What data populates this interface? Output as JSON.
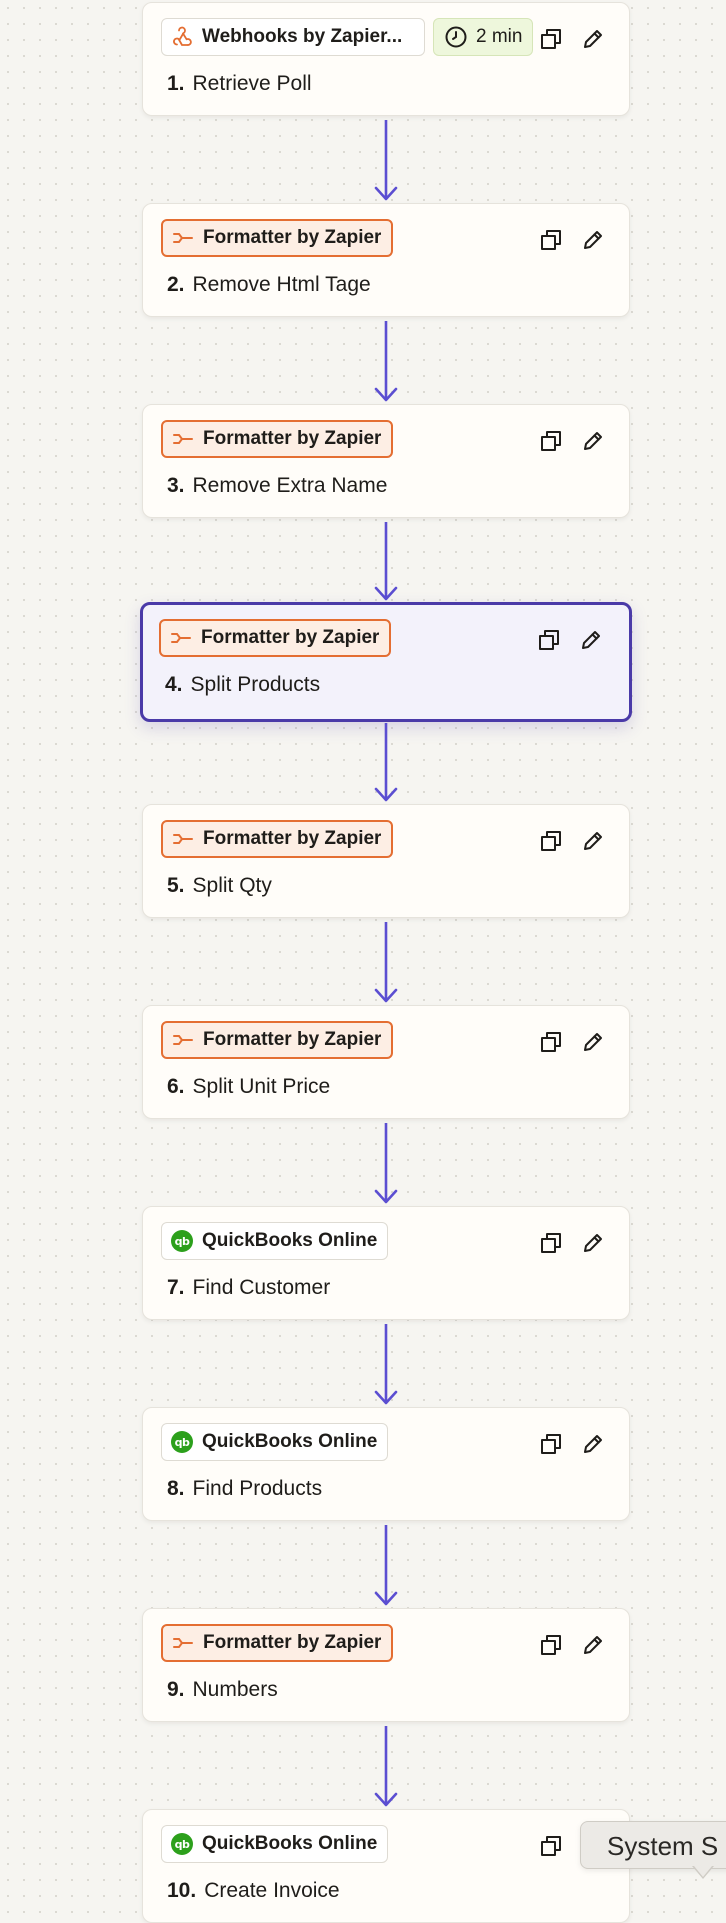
{
  "steps": [
    {
      "number": "1.",
      "title": "Retrieve Poll",
      "app": "Webhooks by Zapier...",
      "app_icon": "webhook-icon",
      "delay": "2 min"
    },
    {
      "number": "2.",
      "title": "Remove Html Tage",
      "app": "Formatter by Zapier",
      "app_icon": "formatter-icon"
    },
    {
      "number": "3.",
      "title": "Remove Extra Name",
      "app": "Formatter by Zapier",
      "app_icon": "formatter-icon"
    },
    {
      "number": "4.",
      "title": "Split Products",
      "app": "Formatter by Zapier",
      "app_icon": "formatter-icon",
      "selected": true
    },
    {
      "number": "5.",
      "title": "Split Qty",
      "app": "Formatter by Zapier",
      "app_icon": "formatter-icon"
    },
    {
      "number": "6.",
      "title": "Split Unit Price",
      "app": "Formatter by Zapier",
      "app_icon": "formatter-icon"
    },
    {
      "number": "7.",
      "title": "Find Customer",
      "app": "QuickBooks Online",
      "app_icon": "quickbooks-icon"
    },
    {
      "number": "8.",
      "title": "Find Products",
      "app": "QuickBooks Online",
      "app_icon": "quickbooks-icon"
    },
    {
      "number": "9.",
      "title": "Numbers",
      "app": "Formatter by Zapier",
      "app_icon": "formatter-icon"
    },
    {
      "number": "10.",
      "title": "Create Invoice",
      "app": "QuickBooks Online",
      "app_icon": "quickbooks-icon"
    }
  ],
  "tooltip": {
    "text": "System S"
  },
  "colors": {
    "connector": "#5b4ed1",
    "selected_border": "#4a3aa8",
    "formatter_accent": "#e46e32",
    "quickbooks_green": "#2ca01c",
    "canvas_bg": "#f6f5f1"
  }
}
